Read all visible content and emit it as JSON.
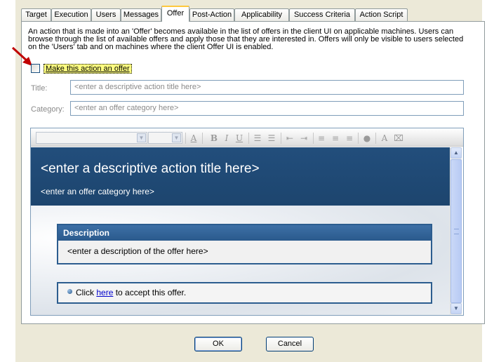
{
  "tabs": [
    {
      "label": "Target",
      "active": false
    },
    {
      "label": "Execution",
      "active": false
    },
    {
      "label": "Users",
      "active": false
    },
    {
      "label": "Messages",
      "active": false
    },
    {
      "label": "Offer",
      "active": true
    },
    {
      "label": "Post-Action",
      "active": false
    },
    {
      "label": "Applicability",
      "active": false
    },
    {
      "label": "Success Criteria",
      "active": false
    },
    {
      "label": "Action Script",
      "active": false
    }
  ],
  "offer": {
    "intro_line1": "An action that is made into an 'Offer' becomes available in the list of offers in the client UI on applicable machines.  Users can",
    "intro_line2": "browse through the list of available offers and apply those that they are interested in.  Offers will only be visible to users selected",
    "intro_line3": "on the 'Users' tab and on machines where the client Offer UI is enabled.",
    "make_offer_label": "Make this action an offer",
    "make_offer_checked": false,
    "title_label": "Title:",
    "title_placeholder": "<enter a descriptive action title here>",
    "category_label": "Category:",
    "category_placeholder": "<enter an offer category here>"
  },
  "editor": {
    "toolbar_icons": [
      "font-color-icon",
      "bold-icon",
      "italic-icon",
      "underline-icon",
      "numbered-list-icon",
      "bullet-list-icon",
      "outdent-icon",
      "indent-icon",
      "align-left-icon",
      "align-center-icon",
      "align-right-icon",
      "insert-link-icon",
      "spell-check-icon",
      "clear-format-icon"
    ],
    "preview_title": "<enter a descriptive action title here>",
    "preview_category": "<enter an offer category here>",
    "description_heading": "Description",
    "description_body": "<enter a description of the offer here>",
    "accept_prefix": "Click ",
    "accept_link": "here",
    "accept_suffix": " to accept this offer."
  },
  "buttons": {
    "ok": "OK",
    "cancel": "Cancel"
  },
  "colors": {
    "hero_background": "#224e7c",
    "highlight": "#ffff80",
    "arrow": "#c00000"
  }
}
